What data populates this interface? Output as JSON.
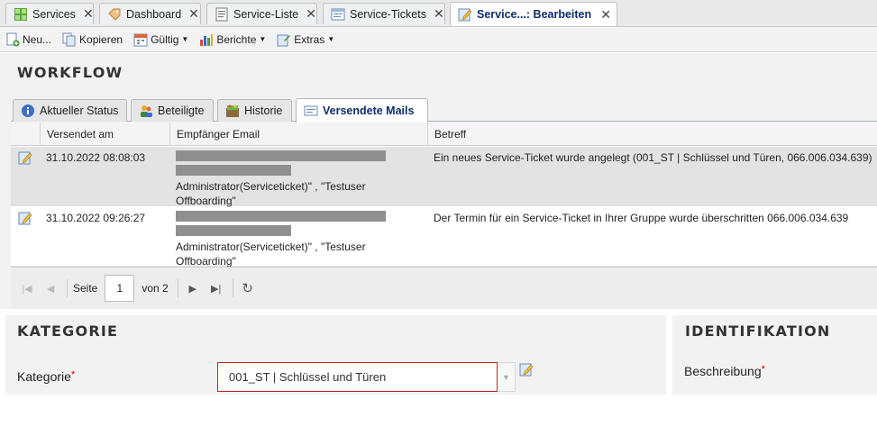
{
  "tabs": [
    {
      "label": "Services",
      "icon": "services-grid-icon",
      "active": false
    },
    {
      "label": "Dashboard",
      "icon": "tag-icon",
      "active": false
    },
    {
      "label": "Service-Liste",
      "icon": "list-icon",
      "active": false
    },
    {
      "label": "Service-Tickets",
      "icon": "ticket-icon",
      "active": false
    },
    {
      "label": "Service...: Bearbeiten",
      "icon": "edit-form-icon",
      "active": true
    }
  ],
  "toolbar": {
    "new_label": "Neu...",
    "copy_label": "Kopieren",
    "valid_label": "Gültig",
    "reports_label": "Berichte",
    "extras_label": "Extras"
  },
  "workflow": {
    "title": "WORKFLOW",
    "tabs": [
      {
        "label": "Aktueller Status",
        "icon": "info-icon"
      },
      {
        "label": "Beteiligte",
        "icon": "users-icon"
      },
      {
        "label": "Historie",
        "icon": "history-icon"
      },
      {
        "label": "Versendete Mails",
        "icon": "mail-icon"
      }
    ],
    "columns": [
      "Versendet am",
      "Empfänger Email",
      "Betreff"
    ],
    "rows": [
      {
        "date": "31.10.2022 08:08:03",
        "recipient_line1": "Administrator(Serviceticket)\" , \"Testuser",
        "recipient_line2": "Offboarding\"",
        "subject": "Ein neues Service-Ticket wurde angelegt (001_ST | Schlüssel und Türen, 066.006.034.639)"
      },
      {
        "date": "31.10.2022 09:26:27",
        "recipient_line1": "Administrator(Serviceticket)\" , \"Testuser",
        "recipient_line2": "Offboarding\"",
        "subject": "Der Termin für ein Service-Ticket in Ihrer Gruppe wurde überschritten 066.006.034.639"
      }
    ],
    "pager": {
      "page_label": "Seite",
      "current_page": "1",
      "of_label": "von 2"
    }
  },
  "kategorie": {
    "title": "KATEGORIE",
    "field_label": "Kategorie",
    "required_mark": "*",
    "value": "001_ST | Schlüssel und Türen"
  },
  "identifikation": {
    "title": "IDENTIFIKATION",
    "field_label": "Beschreibung",
    "required_mark": "*"
  },
  "colors": {
    "active_tab_text": "#0f2d6b",
    "required": "#d40000",
    "invalid_border": "#cc2222",
    "selected_row": "#e3e3e3"
  }
}
